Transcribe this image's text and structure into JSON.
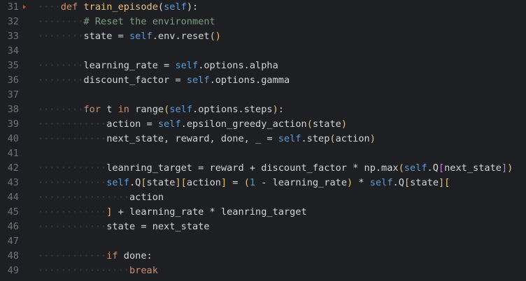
{
  "editor": {
    "lines": [
      {
        "no": "31",
        "indent": "····",
        "tokens": [
          {
            "t": "def ",
            "c": "kw"
          },
          {
            "t": "train_episode",
            "c": "fndef2"
          },
          {
            "t": "(",
            "c": "plain"
          },
          {
            "t": "self",
            "c": "kw2"
          },
          {
            "t": "):",
            "c": "plain"
          }
        ],
        "marker": true
      },
      {
        "no": "32",
        "indent": "········",
        "tokens": [
          {
            "t": "# Reset the environment",
            "c": "cm"
          }
        ]
      },
      {
        "no": "33",
        "indent": "········",
        "tokens": [
          {
            "t": "state = ",
            "c": "plain"
          },
          {
            "t": "self",
            "c": "kw2"
          },
          {
            "t": ".env.reset",
            "c": "plain"
          },
          {
            "t": "()",
            "c": "paren1"
          }
        ]
      },
      {
        "no": "34",
        "indent": "",
        "tokens": []
      },
      {
        "no": "35",
        "indent": "········",
        "tokens": [
          {
            "t": "learning_rate = ",
            "c": "plain"
          },
          {
            "t": "self",
            "c": "kw2"
          },
          {
            "t": ".options.alpha",
            "c": "plain"
          }
        ]
      },
      {
        "no": "36",
        "indent": "········",
        "tokens": [
          {
            "t": "discount_factor = ",
            "c": "plain"
          },
          {
            "t": "self",
            "c": "kw2"
          },
          {
            "t": ".options.gamma",
            "c": "plain"
          }
        ]
      },
      {
        "no": "37",
        "indent": "",
        "tokens": []
      },
      {
        "no": "38",
        "indent": "········",
        "tokens": [
          {
            "t": "for ",
            "c": "kw"
          },
          {
            "t": "t ",
            "c": "plain"
          },
          {
            "t": "in ",
            "c": "kw"
          },
          {
            "t": "range",
            "c": "plain"
          },
          {
            "t": "(",
            "c": "paren1"
          },
          {
            "t": "self",
            "c": "kw2"
          },
          {
            "t": ".options.steps",
            "c": "plain"
          },
          {
            "t": "):",
            "c": "paren1"
          }
        ]
      },
      {
        "no": "39",
        "indent": "············",
        "tokens": [
          {
            "t": "action = ",
            "c": "plain"
          },
          {
            "t": "self",
            "c": "kw2"
          },
          {
            "t": ".epsilon_greedy_action",
            "c": "plain"
          },
          {
            "t": "(",
            "c": "paren1"
          },
          {
            "t": "state",
            "c": "plain"
          },
          {
            "t": ")",
            "c": "paren1"
          }
        ]
      },
      {
        "no": "40",
        "indent": "············",
        "tokens": [
          {
            "t": "next_state, reward, done, _ = ",
            "c": "plain"
          },
          {
            "t": "self",
            "c": "kw2"
          },
          {
            "t": ".step",
            "c": "plain"
          },
          {
            "t": "(",
            "c": "paren1"
          },
          {
            "t": "action",
            "c": "plain"
          },
          {
            "t": ")",
            "c": "paren1"
          }
        ]
      },
      {
        "no": "41",
        "indent": "",
        "tokens": []
      },
      {
        "no": "42",
        "indent": "············",
        "tokens": [
          {
            "t": "leanring_target = reward + discount_factor * np.max",
            "c": "plain"
          },
          {
            "t": "(",
            "c": "paren1"
          },
          {
            "t": "self",
            "c": "kw2"
          },
          {
            "t": ".Q",
            "c": "plain"
          },
          {
            "t": "[",
            "c": "paren2"
          },
          {
            "t": "next_state",
            "c": "plain"
          },
          {
            "t": "]",
            "c": "paren2"
          },
          {
            "t": ")",
            "c": "paren1"
          }
        ]
      },
      {
        "no": "43",
        "indent": "············",
        "tokens": [
          {
            "t": "self",
            "c": "kw2"
          },
          {
            "t": ".Q",
            "c": "plain"
          },
          {
            "t": "[",
            "c": "paren1"
          },
          {
            "t": "state",
            "c": "plain"
          },
          {
            "t": "][",
            "c": "paren1"
          },
          {
            "t": "action",
            "c": "plain"
          },
          {
            "t": "]",
            "c": "paren1"
          },
          {
            "t": " = ",
            "c": "plain"
          },
          {
            "t": "(",
            "c": "paren1"
          },
          {
            "t": "1",
            "c": "num"
          },
          {
            "t": " - learning_rate",
            "c": "plain"
          },
          {
            "t": ")",
            "c": "paren1"
          },
          {
            "t": " * ",
            "c": "plain"
          },
          {
            "t": "self",
            "c": "kw2"
          },
          {
            "t": ".Q",
            "c": "plain"
          },
          {
            "t": "[",
            "c": "paren1"
          },
          {
            "t": "state",
            "c": "plain"
          },
          {
            "t": "][",
            "c": "paren1"
          }
        ]
      },
      {
        "no": "44",
        "indent": "················",
        "tokens": [
          {
            "t": "action",
            "c": "plain"
          }
        ]
      },
      {
        "no": "45",
        "indent": "············",
        "tokens": [
          {
            "t": "]",
            "c": "paren1"
          },
          {
            "t": " + learning_rate * leanring_target",
            "c": "plain"
          }
        ]
      },
      {
        "no": "46",
        "indent": "············",
        "tokens": [
          {
            "t": "state = next_state",
            "c": "plain"
          }
        ]
      },
      {
        "no": "47",
        "indent": "",
        "tokens": []
      },
      {
        "no": "48",
        "indent": "············",
        "tokens": [
          {
            "t": "if ",
            "c": "kw"
          },
          {
            "t": "done:",
            "c": "plain"
          }
        ]
      },
      {
        "no": "49",
        "indent": "················",
        "tokens": [
          {
            "t": "break",
            "c": "kw"
          }
        ]
      }
    ]
  },
  "colors": {
    "background": "#1e1f22",
    "line_number": "#6f737a",
    "keyword": "#cf8e6d",
    "self": "#94558d",
    "comment": "#7a9e7e",
    "function_name": "#56a8f5",
    "bracket": "#e5c07b",
    "marker": "#d0452f"
  }
}
